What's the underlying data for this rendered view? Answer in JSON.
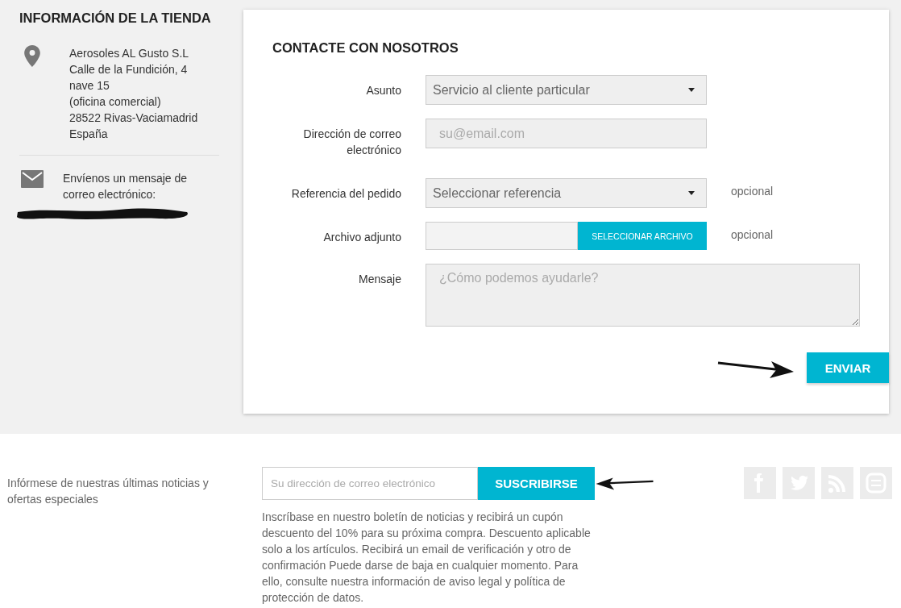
{
  "store_info": {
    "title": "INFORMACIÓN DE LA TIENDA",
    "address_lines": [
      "Aerosoles AL Gusto S.L",
      "Calle de la Fundición, 4",
      "nave 15",
      "(oficina comercial)",
      "28522 Rivas-Vaciamadrid",
      "España"
    ],
    "email_label": "Envíenos un mensaje de correo electrónico:"
  },
  "contact_form": {
    "title": "CONTACTE CON NOSOTROS",
    "fields": [
      {
        "kind": "select",
        "label": "Asunto",
        "value": "Servicio al cliente particular"
      },
      {
        "kind": "input",
        "label": "Dirección de correo electrónico",
        "placeholder": "su@email.com"
      },
      {
        "kind": "select",
        "label": "Referencia del pedido",
        "value": "Seleccionar referencia",
        "note": "opcional"
      },
      {
        "kind": "file",
        "label": "Archivo adjunto",
        "button": "SELECCIONAR ARCHIVO",
        "note": "opcional"
      },
      {
        "kind": "textarea",
        "label": "Mensaje",
        "placeholder": "¿Cómo podemos ayudarle?"
      }
    ],
    "submit": "ENVIAR"
  },
  "newsletter": {
    "description": "Infórmese de nuestras últimas noticias y ofertas especiales",
    "placeholder": "Su dirección de correo electrónico",
    "button": "SUSCRIBIRSE",
    "legal": "Inscríbase en nuestro boletín de noticias y recibirá un cupón descuento del 10% para su próxima compra. Descuento aplicable solo a los artículos. Recibirá un email de verificación y otro de confirmación Puede darse de baja en cualquier momento. Para ello, consulte nuestra información de aviso legal y política de protección de datos."
  }
}
